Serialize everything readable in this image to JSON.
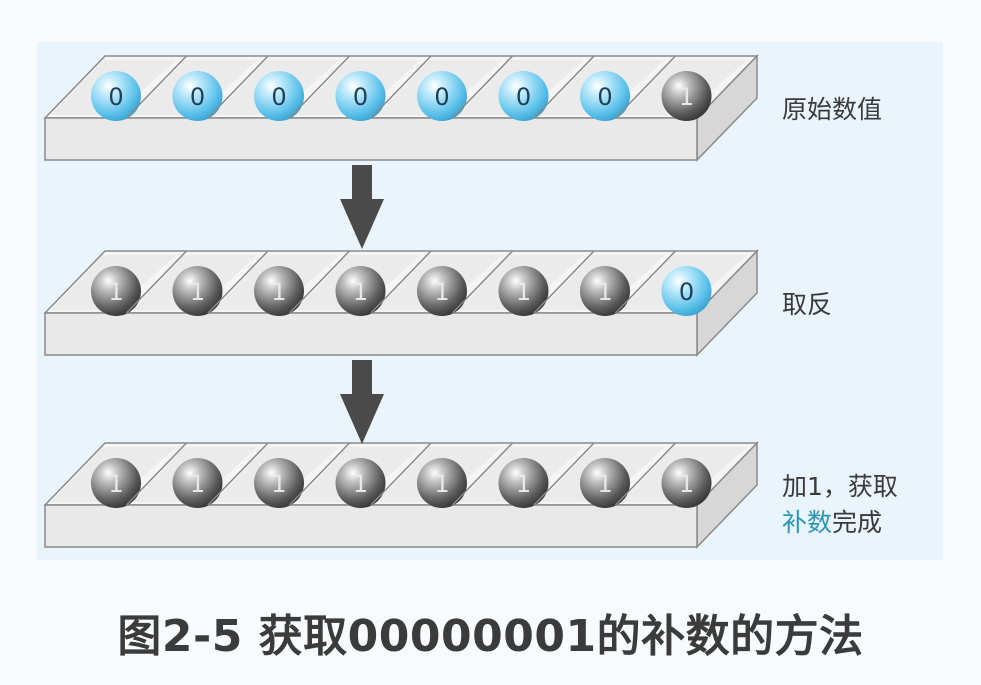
{
  "trays": [
    {
      "bits": [
        "0",
        "0",
        "0",
        "0",
        "0",
        "0",
        "0",
        "1"
      ],
      "label_lines": [
        [
          {
            "text": "原始数值",
            "highlight": false
          }
        ]
      ]
    },
    {
      "bits": [
        "1",
        "1",
        "1",
        "1",
        "1",
        "1",
        "1",
        "0"
      ],
      "label_lines": [
        [
          {
            "text": "取反",
            "highlight": false
          }
        ]
      ]
    },
    {
      "bits": [
        "1",
        "1",
        "1",
        "1",
        "1",
        "1",
        "1",
        "1"
      ],
      "label_lines": [
        [
          {
            "text": "加1，获取",
            "highlight": false
          }
        ],
        [
          {
            "text": "补数",
            "highlight": true
          },
          {
            "text": "完成",
            "highlight": false
          }
        ]
      ]
    }
  ],
  "caption": "图2-5 获取00000001的补数的方法",
  "colors": {
    "ball_zero": "#6dc9ee",
    "ball_one": "#5a5a5a",
    "tray_face": "#e9e9e9",
    "tray_top": "#f5f5f5",
    "tray_edge": "#8a8a8a",
    "arrow": "#4a4a4a",
    "highlight_text": "#2b95b2"
  }
}
